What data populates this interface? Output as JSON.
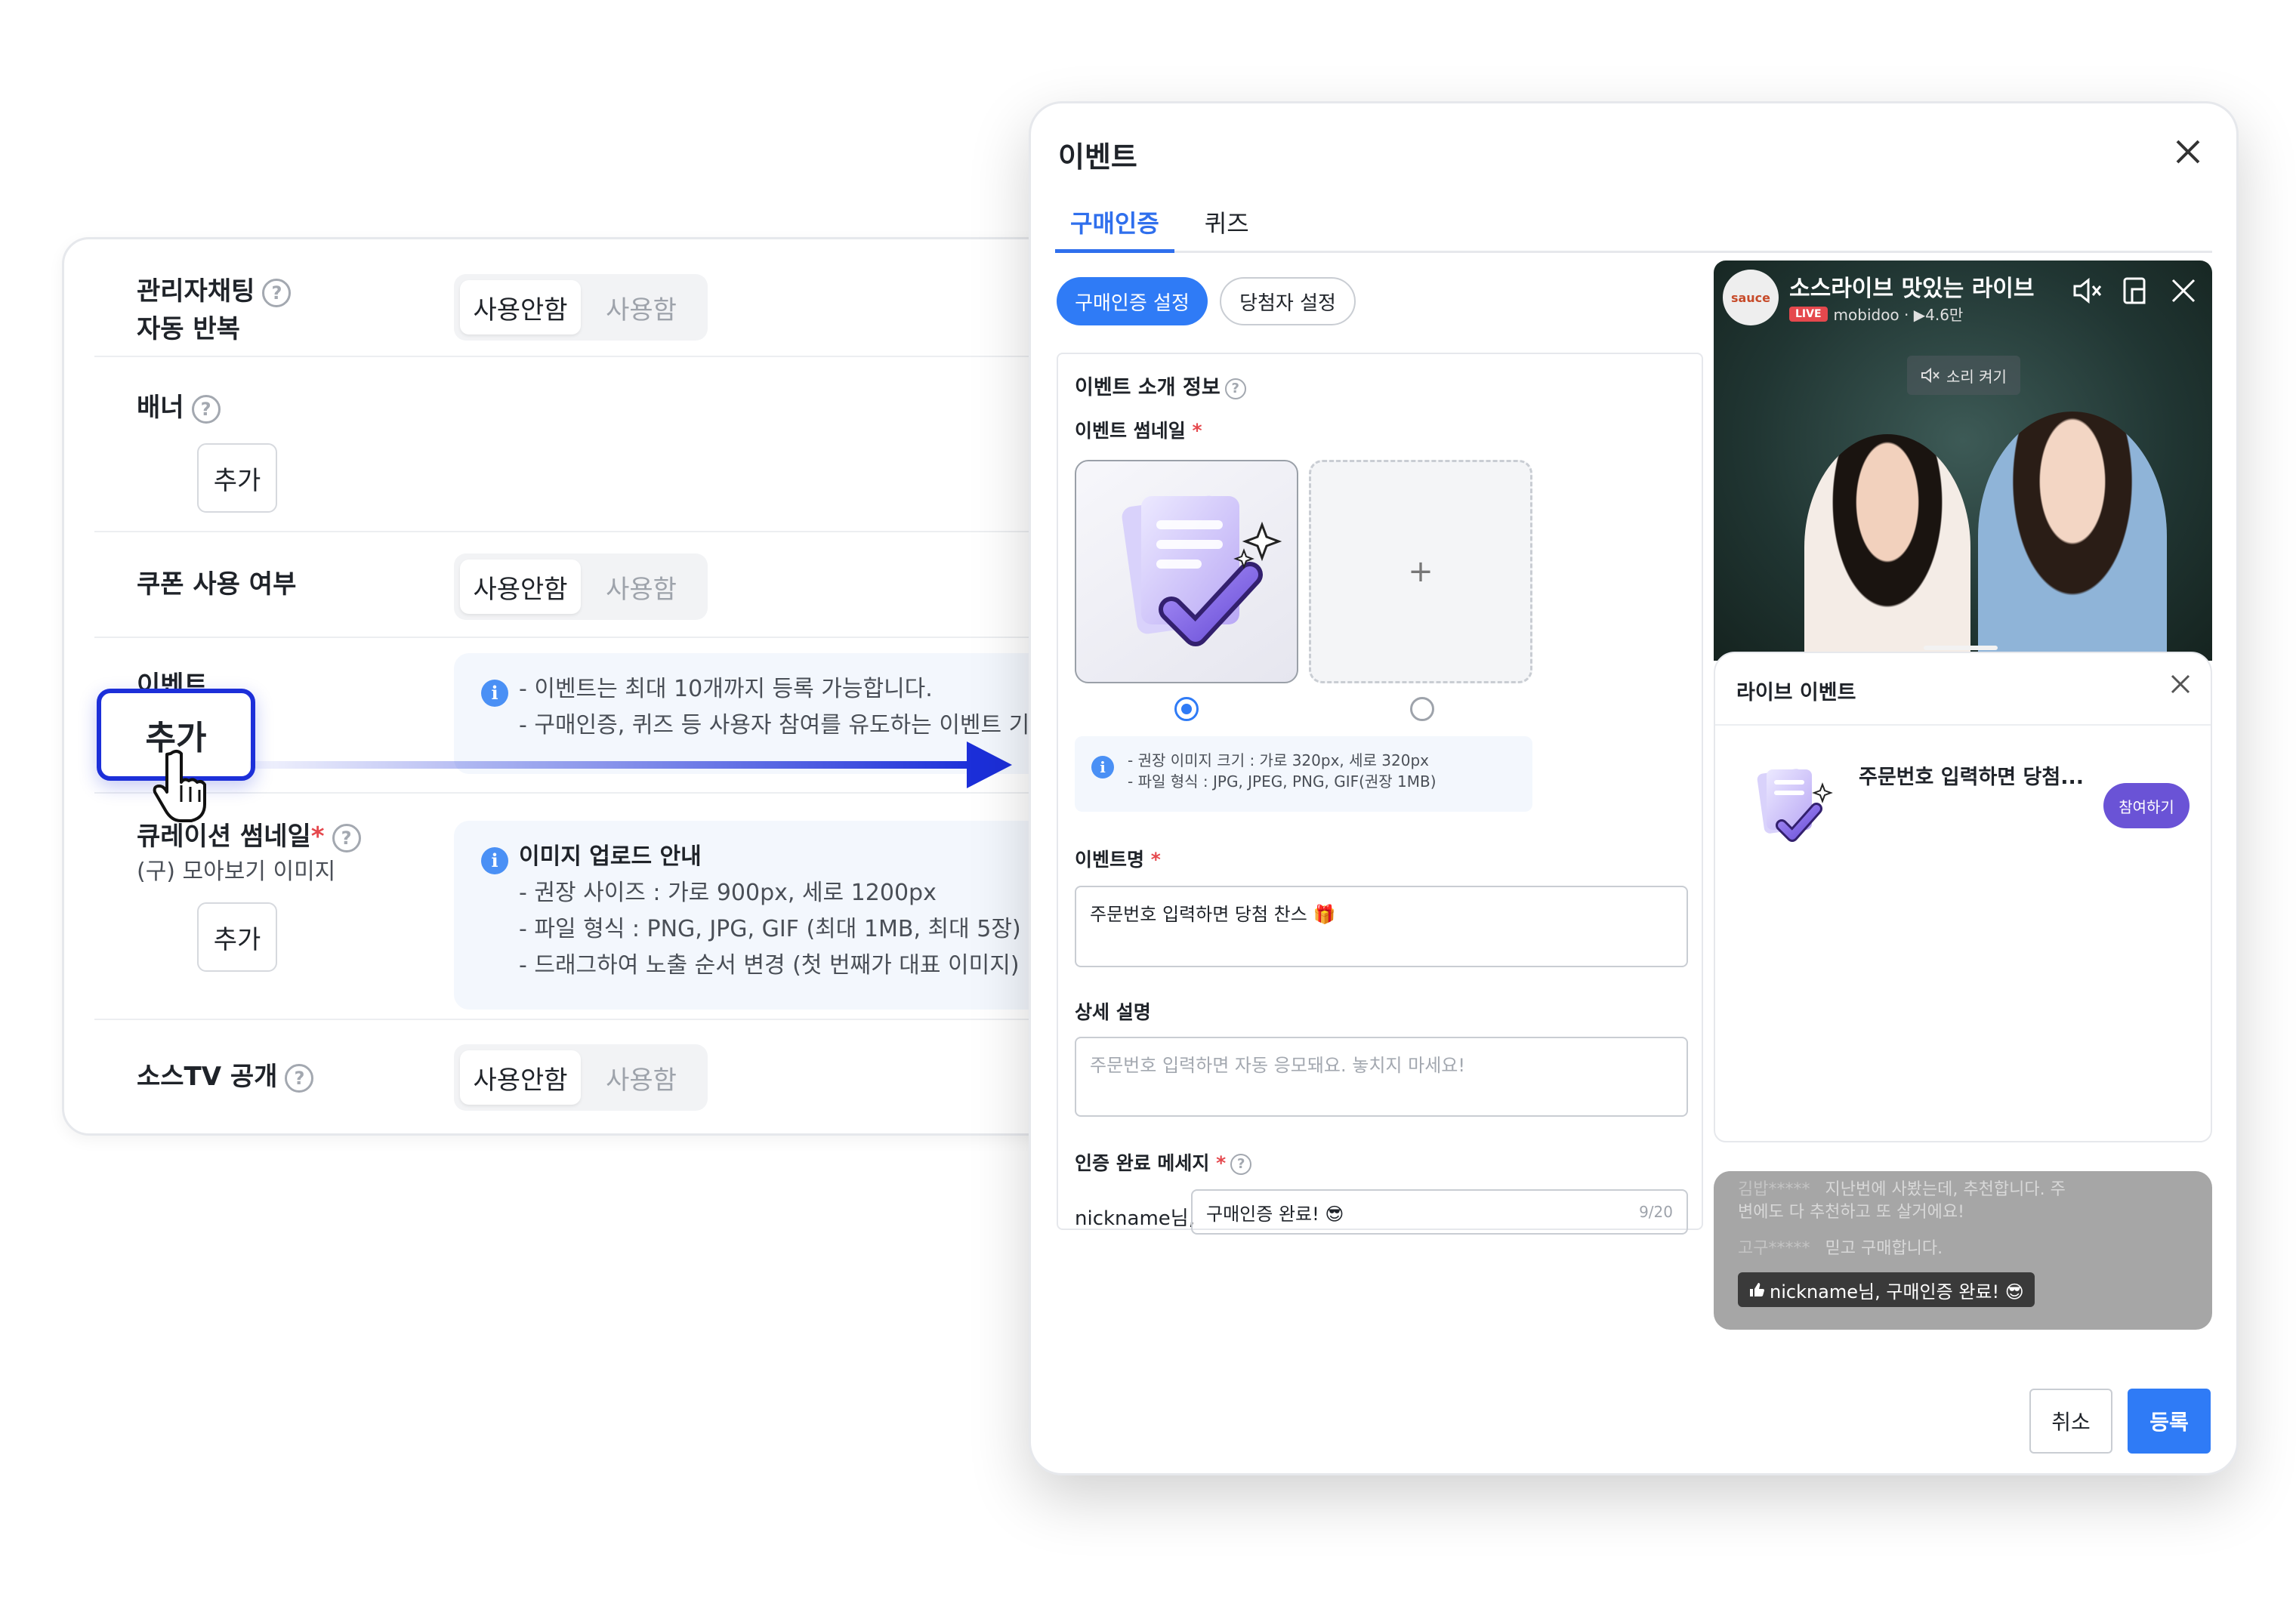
{
  "settings": {
    "admin_chat": {
      "label_line1": "관리자채팅",
      "label_line2": "자동 반복",
      "off": "사용안함",
      "on": "사용함"
    },
    "banner": {
      "label": "배너",
      "add": "추가"
    },
    "coupon": {
      "label": "쿠폰 사용 여부",
      "off": "사용안함",
      "on": "사용함"
    },
    "event": {
      "label": "이벤트",
      "add": "추가",
      "info_line1": "- 이벤트는 최대 10개까지 등록 가능합니다.",
      "info_line2": "- 구매인증, 퀴즈 등 사용자 참여를 유도하는 이벤트 기능을 추가"
    },
    "curation": {
      "label": "큐레이션 썸네일",
      "required": "*",
      "sub": "(구) 모아보기 이미지",
      "add": "추가",
      "info_title": "이미지 업로드 안내",
      "info_lines": [
        "- 권장 사이즈 : 가로 900px, 세로 1200px",
        "- 파일 형식 : PNG, JPG, GIF (최대 1MB, 최대 5장)",
        "- 드래그하여 노출 순서 변경 (첫 번째가 대표 이미지)"
      ]
    },
    "saucetv": {
      "label": "소스TV 공개",
      "off": "사용안함",
      "on": "사용함"
    }
  },
  "modal": {
    "title": "이벤트",
    "tabs": [
      "구매인증",
      "퀴즈"
    ],
    "pills": {
      "active": "구매인증 설정",
      "inactive": "당첨자 설정"
    },
    "form": {
      "section_title": "이벤트 소개 정보",
      "thumb_label": "이벤트 썸네일",
      "required": "*",
      "add_symbol": "+",
      "tip_line1": "- 권장 이미지 크기 : 가로 320px, 세로 320px",
      "tip_line2": "- 파일 형식 : JPG, JPEG, PNG, GIF(권장 1MB)",
      "name_label": "이벤트명",
      "name_value": "주문번호 입력하면 당첨 찬스 🎁",
      "desc_label": "상세 설명",
      "desc_placeholder": "주문번호 입력하면 자동 응모돼요. 놓치지 마세요!",
      "msg_label": "인증 완료 메세지",
      "nick_prefix": "nickname님,",
      "msg_value": "구매인증 완료! 😎",
      "msg_count": "9/20"
    },
    "preview": {
      "logo": "sauce",
      "video_title": "소스라이브 맛있는 라이브",
      "live_badge": "LIVE",
      "channel": "mobidoo · ▶4.6만",
      "mute_label": "소리 켜기",
      "event_head": "라이브 이벤트",
      "event_title": "주문번호 입력하면 당첨...",
      "join": "참여하기",
      "chat1_user": "김밥*****",
      "chat1_text": "지난번에 사봤는데, 추천합니다. 주",
      "chat1_text2": "변에도 다 추천하고 또 살거에요!",
      "chat2_user": "고구*****",
      "chat2_text": "믿고 구매합니다.",
      "badge_text": "nickname님, 구매인증 완료! 😎"
    },
    "cancel": "취소",
    "submit": "등록"
  },
  "colors": {
    "primary": "#2f7bf6",
    "focus": "#1c2fd9",
    "join": "#6a53d6",
    "required": "#e5484d"
  },
  "icons": [
    "help-icon",
    "info-icon",
    "close-icon",
    "mute-icon",
    "pip-icon",
    "hand-cursor-icon",
    "arrow-right-icon",
    "thumbs-up-icon"
  ]
}
